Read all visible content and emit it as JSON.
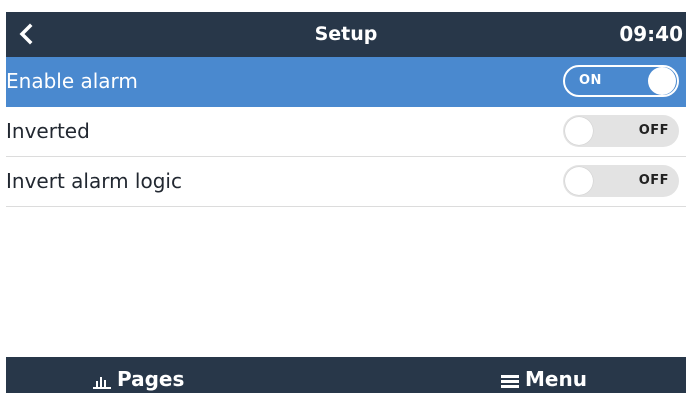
{
  "header": {
    "title": "Setup",
    "time": "09:40"
  },
  "settings": [
    {
      "label": "Enable alarm",
      "state": "ON",
      "selected": true
    },
    {
      "label": "Inverted",
      "state": "OFF",
      "selected": false
    },
    {
      "label": "Invert alarm logic",
      "state": "OFF",
      "selected": false
    }
  ],
  "footer": {
    "pages_label": "Pages",
    "pages_icon": "bar-chart-icon",
    "menu_label": "Menu",
    "menu_icon": "hamburger-icon"
  },
  "colors": {
    "header_bg": "#283749",
    "selected_row_bg": "#4a89cf",
    "toggle_off_bg": "#e3e3e3"
  }
}
